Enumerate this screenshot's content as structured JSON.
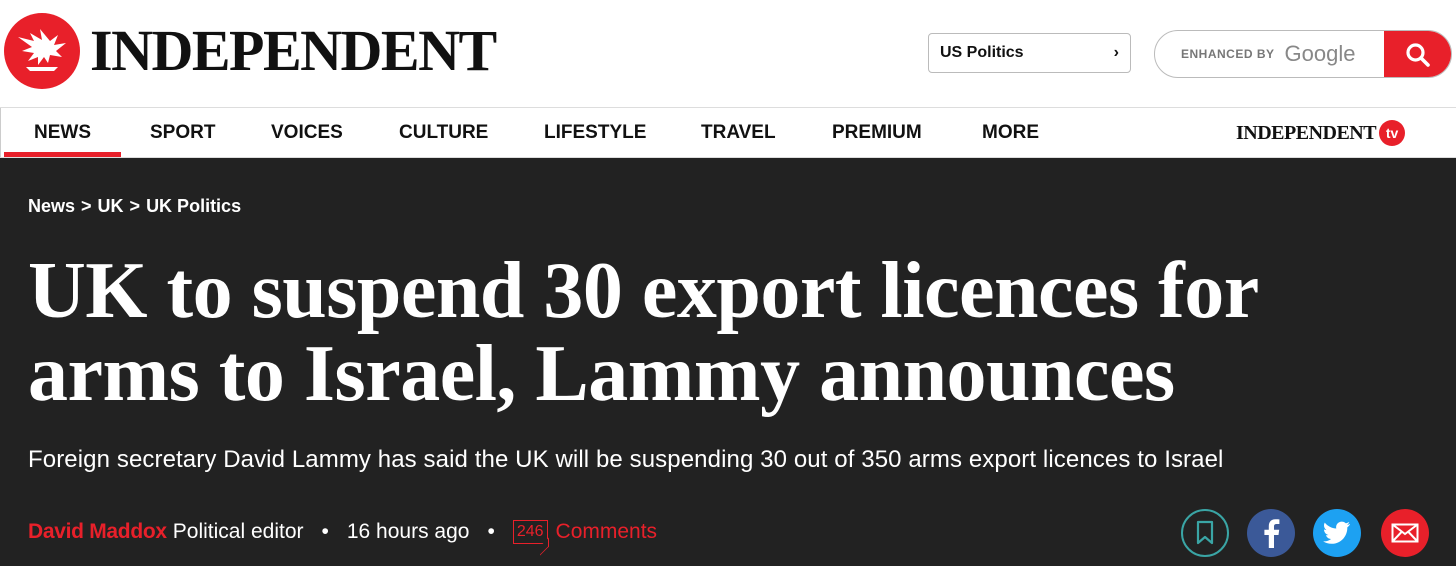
{
  "brand": {
    "name": "INDEPENDENT",
    "accent": "#e8202a"
  },
  "edition": {
    "label": "US Politics",
    "chevron": "›"
  },
  "search": {
    "enhanced_by": "ENHANCED BY",
    "provider": "Google",
    "button_icon": "search-icon"
  },
  "nav": {
    "items": [
      {
        "label": "NEWS",
        "active": true
      },
      {
        "label": "SPORT"
      },
      {
        "label": "VOICES"
      },
      {
        "label": "CULTURE"
      },
      {
        "label": "LIFESTYLE"
      },
      {
        "label": "TRAVEL"
      },
      {
        "label": "PREMIUM"
      },
      {
        "label": "MORE"
      }
    ],
    "tv_word": "INDEPENDENT",
    "tv_badge": "tv"
  },
  "breadcrumb": [
    {
      "label": "News"
    },
    {
      "sep": ">"
    },
    {
      "label": "UK"
    },
    {
      "sep": ">"
    },
    {
      "label": "UK Politics"
    }
  ],
  "article": {
    "headline": "UK to suspend 30 export licences for arms to Israel, Lammy announces",
    "standfirst": "Foreign secretary David Lammy has said the UK will be suspending 30 out of 350 arms export licences to Israel",
    "author": "David Maddox",
    "role": "Political editor",
    "bullet": "•",
    "time_ago": "16 hours ago",
    "comment_count": "246",
    "comments_label": "Comments"
  },
  "share": [
    "bookmark-icon",
    "facebook-icon",
    "twitter-icon",
    "email-icon"
  ],
  "colors": {
    "hero_bg": "#222222",
    "facebook": "#3b5998",
    "twitter": "#1da1f2",
    "bookmark_ring": "#3aa5a5"
  }
}
